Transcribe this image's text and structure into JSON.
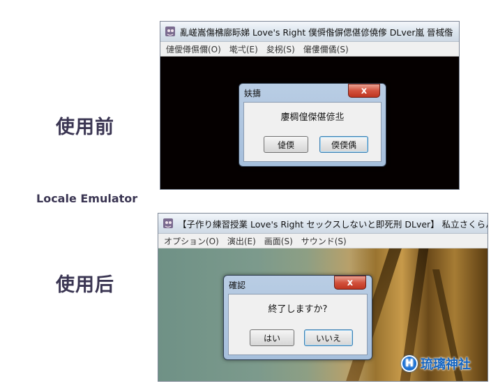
{
  "labels": {
    "before": "使用前",
    "tool": "Locale Emulator",
    "after": "使用后"
  },
  "top_window": {
    "title": "亂嵯嵩傷梻廍眎娣 Love's Right 僕僢偺偋偲偡偐僥偧 DLver嵐 晉棫偺",
    "menu": [
      "僆僾僔儑儞(O)",
      "墘弌(E)",
      "夋柺(S)",
      "僒僂儞僪(S)"
    ],
    "dialog": {
      "title": "妋擣",
      "message": "廔椆偟傑偡偐丠",
      "buttons": [
        "偼偄",
        "偄偄偊"
      ],
      "close": "x"
    }
  },
  "bottom_window": {
    "title": "【子作り練習授業 Love's Right セックスしないと即死刑 DLver】 私立さくらんぼ",
    "menu": [
      "オプション(O)",
      "演出(E)",
      "画面(S)",
      "サウンド(S)"
    ],
    "dialog": {
      "title": "確認",
      "message": "終了しますか?",
      "buttons": [
        "はい",
        "いいえ"
      ],
      "close": "x"
    }
  },
  "watermark": {
    "logo_letter": "H",
    "text": "琉璃神社"
  },
  "colors": {
    "label": "#3a3552",
    "dialog_frame": "#a6bfdc",
    "close_button": "#c94a36",
    "watermark": "#1565c0"
  }
}
